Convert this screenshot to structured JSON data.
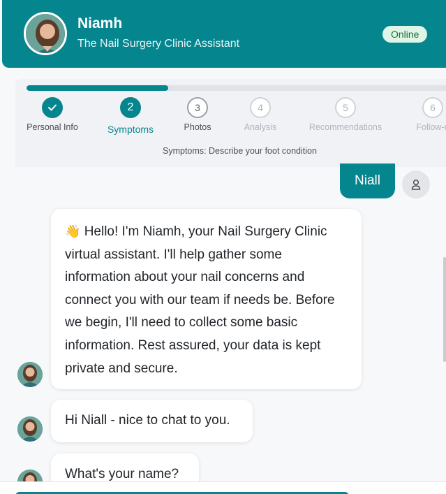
{
  "header": {
    "name": "Niamh",
    "subtitle": "The Nail Surgery Clinic Assistant",
    "status": "Online"
  },
  "progress": {
    "fraction": 0.333,
    "steps": [
      {
        "label": "Personal Info",
        "number": "✓",
        "state": "done"
      },
      {
        "label": "Symptoms",
        "number": "2",
        "state": "current"
      },
      {
        "label": "Photos",
        "number": "3",
        "state": "future"
      },
      {
        "label": "Analysis",
        "number": "4",
        "state": "future-dim"
      },
      {
        "label": "Recommendations",
        "number": "5",
        "state": "future-dim"
      },
      {
        "label": "Follow-u",
        "number": "6",
        "state": "future-dim"
      }
    ],
    "description": "Symptoms: Describe your foot condition"
  },
  "chat": {
    "user_message": "Niall",
    "messages": [
      "Hello! I'm Niamh, your Nail Surgery Clinic virtual assistant. I'll help gather some information about your nail concerns and connect you with our team if needs be. Before we begin, I'll need to collect some basic information. Rest assured, your data is kept private and secure.",
      "Hi Niall - nice to chat to you.",
      "What's your name?"
    ],
    "wave_emoji": "👋"
  },
  "colors": {
    "brand": "#05858e",
    "online_bg": "#dff5e6",
    "online_text": "#1f6b3a"
  },
  "icons": {
    "user": "user-icon",
    "check": "check-icon"
  }
}
